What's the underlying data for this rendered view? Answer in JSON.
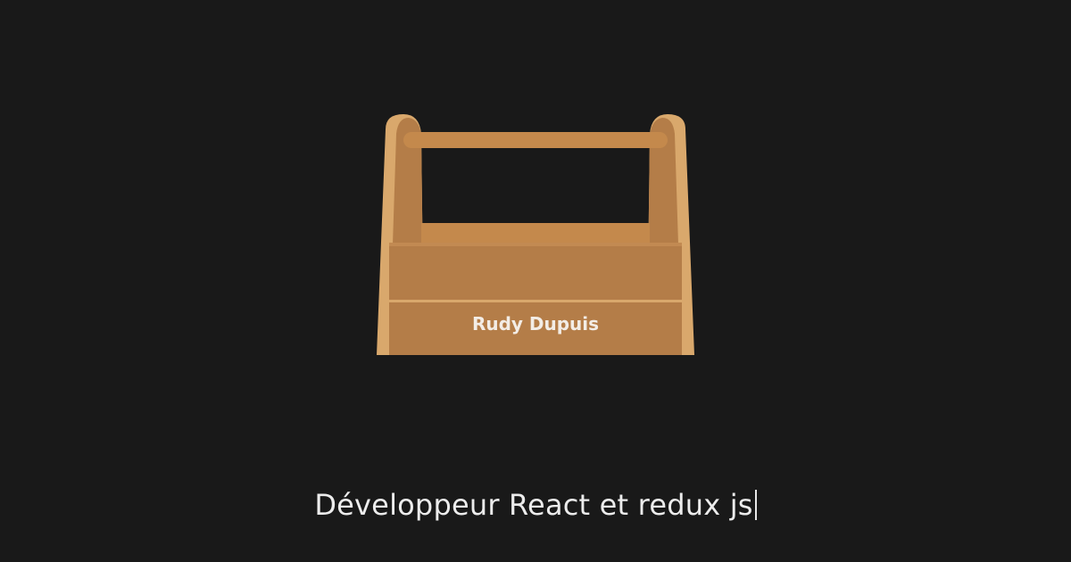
{
  "toolbox": {
    "name": "Rudy Dupuis",
    "colors": {
      "wood": "#b47d48",
      "wood_light": "#d9a86c",
      "wood_dark": "#9c6a3b",
      "handle": "#c4894c"
    }
  },
  "tagline": {
    "text": "Développeur React et redux js"
  },
  "colors": {
    "background": "#191919",
    "text": "#ececec"
  }
}
